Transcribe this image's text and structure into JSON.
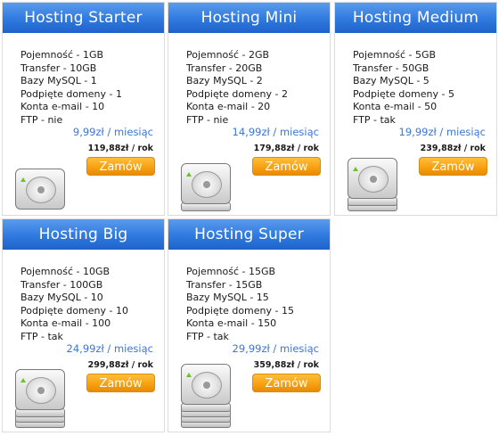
{
  "plans": [
    {
      "name": "Hosting Starter",
      "specs": [
        "Pojemność - 1GB",
        "Transfer - 10GB",
        "Bazy MySQL - 1",
        "Podpięte domeny - 1",
        "Konta e-mail - 10",
        "FTP - nie"
      ],
      "price_month": "9,99zł / miesiąc",
      "price_year": "119,88zł / rok",
      "order_label": "Zamów",
      "drives": 1
    },
    {
      "name": "Hosting Mini",
      "specs": [
        "Pojemność - 2GB",
        "Transfer - 20GB",
        "Bazy MySQL - 2",
        "Podpięte domeny - 2",
        "Konta e-mail - 20",
        "FTP - nie"
      ],
      "price_month": "14,99zł / miesiąc",
      "price_year": "179,88zł / rok",
      "order_label": "Zamów",
      "drives": 2
    },
    {
      "name": "Hosting Medium",
      "specs": [
        "Pojemność - 5GB",
        "Transfer - 50GB",
        "Bazy MySQL - 5",
        "Podpięte domeny - 5",
        "Konta e-mail - 50",
        "FTP - tak"
      ],
      "price_month": "19,99zł / miesiąc",
      "price_year": "239,88zł / rok",
      "order_label": "Zamów",
      "drives": 3
    },
    {
      "name": "Hosting Big",
      "specs": [
        "Pojemność - 10GB",
        "Transfer - 100GB",
        "Bazy MySQL - 10",
        "Podpięte domeny - 10",
        "Konta e-mail - 100",
        "FTP - tak"
      ],
      "price_month": "24,99zł / miesiąc",
      "price_year": "299,88zł / rok",
      "order_label": "Zamów",
      "drives": 4
    },
    {
      "name": "Hosting Super",
      "specs": [
        "Pojemność - 15GB",
        "Transfer - 15GB",
        "Bazy MySQL - 15",
        "Podpięte domeny - 15",
        "Konta e-mail - 150",
        "FTP - tak"
      ],
      "price_month": "29,99zł / miesiąc",
      "price_year": "359,88zł / rok",
      "order_label": "Zamów",
      "drives": 5
    }
  ],
  "icons": {
    "plan_icon": "hard-drive-icon"
  },
  "colors": {
    "header_blue": "#2f79df",
    "price_blue": "#3a77d6",
    "order_orange": "#f7a113"
  }
}
